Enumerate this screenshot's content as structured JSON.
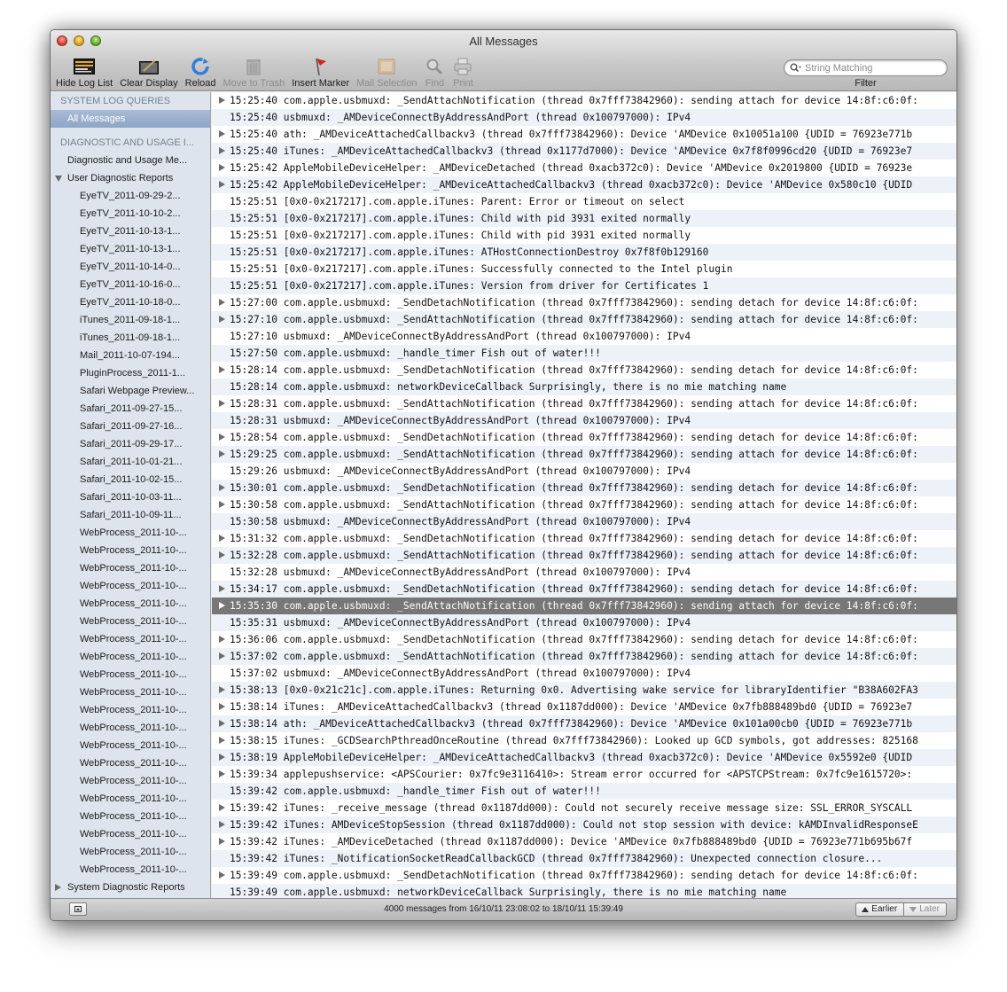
{
  "window": {
    "title": "All Messages"
  },
  "toolbar": {
    "hide_log_list": "Hide Log List",
    "clear_display": "Clear Display",
    "reload": "Reload",
    "move_to_trash": "Move to Trash",
    "insert_marker": "Insert Marker",
    "mail_selection": "Mail Selection",
    "find": "Find",
    "print": "Print",
    "filter_placeholder": "String Matching",
    "filter_label": "Filter"
  },
  "sidebar": {
    "group_system": "SYSTEM LOG QUERIES",
    "all_messages": "All Messages",
    "group_diagnostic": "DIAGNOSTIC AND USAGE I...",
    "diagnostic_usage": "Diagnostic and Usage Me...",
    "user_reports": "User Diagnostic Reports",
    "reports": [
      "EyeTV_2011-09-29-2...",
      "EyeTV_2011-10-10-2...",
      "EyeTV_2011-10-13-1...",
      "EyeTV_2011-10-13-1...",
      "EyeTV_2011-10-14-0...",
      "EyeTV_2011-10-16-0...",
      "EyeTV_2011-10-18-0...",
      "iTunes_2011-09-18-1...",
      "iTunes_2011-09-18-1...",
      "Mail_2011-10-07-194...",
      "PluginProcess_2011-1...",
      "Safari Webpage Preview...",
      "Safari_2011-09-27-15...",
      "Safari_2011-09-27-16...",
      "Safari_2011-09-29-17...",
      "Safari_2011-10-01-21...",
      "Safari_2011-10-02-15...",
      "Safari_2011-10-03-11...",
      "Safari_2011-10-09-11...",
      "WebProcess_2011-10-...",
      "WebProcess_2011-10-...",
      "WebProcess_2011-10-...",
      "WebProcess_2011-10-...",
      "WebProcess_2011-10-...",
      "WebProcess_2011-10-...",
      "WebProcess_2011-10-...",
      "WebProcess_2011-10-...",
      "WebProcess_2011-10-...",
      "WebProcess_2011-10-...",
      "WebProcess_2011-10-...",
      "WebProcess_2011-10-...",
      "WebProcess_2011-10-...",
      "WebProcess_2011-10-...",
      "WebProcess_2011-10-...",
      "WebProcess_2011-10-...",
      "WebProcess_2011-10-...",
      "WebProcess_2011-10-...",
      "WebProcess_2011-10-...",
      "WebProcess_2011-10-..."
    ],
    "system_reports": "System Diagnostic Reports"
  },
  "log": [
    {
      "text": "15:25:40 com.apple.usbmuxd: _SendAttachNotification (thread 0x7fff73842960): sending attach for device 14:8f:c6:0f:",
      "expandable": true
    },
    {
      "text": "15:25:40 usbmuxd: _AMDeviceConnectByAddressAndPort (thread 0x100797000): IPv4",
      "expandable": false
    },
    {
      "text": "15:25:40 ath: _AMDeviceAttachedCallbackv3 (thread 0x7fff73842960): Device 'AMDevice 0x10051a100 {UDID = 76923e771b",
      "expandable": true
    },
    {
      "text": "15:25:40 iTunes: _AMDeviceAttachedCallbackv3 (thread 0x1177d7000): Device 'AMDevice 0x7f8f0996cd20 {UDID = 76923e7",
      "expandable": true
    },
    {
      "text": "15:25:42 AppleMobileDeviceHelper: _AMDeviceDetached (thread 0xacb372c0): Device 'AMDevice 0x2019800 {UDID = 76923e",
      "expandable": true
    },
    {
      "text": "15:25:42 AppleMobileDeviceHelper: _AMDeviceAttachedCallbackv3 (thread 0xacb372c0): Device 'AMDevice 0x580c10 {UDID",
      "expandable": true
    },
    {
      "text": "15:25:51 [0x0-0x217217].com.apple.iTunes: Parent: Error or timeout on select",
      "expandable": false
    },
    {
      "text": "15:25:51 [0x0-0x217217].com.apple.iTunes: Child with pid 3931 exited normally",
      "expandable": false
    },
    {
      "text": "15:25:51 [0x0-0x217217].com.apple.iTunes: Child with pid 3931 exited normally",
      "expandable": false
    },
    {
      "text": "15:25:51 [0x0-0x217217].com.apple.iTunes: ATHostConnectionDestroy 0x7f8f0b129160",
      "expandable": false
    },
    {
      "text": "15:25:51 [0x0-0x217217].com.apple.iTunes: Successfully connected to the Intel plugin",
      "expandable": false
    },
    {
      "text": "15:25:51 [0x0-0x217217].com.apple.iTunes: Version from driver for Certificates 1",
      "expandable": false
    },
    {
      "text": "15:27:00 com.apple.usbmuxd: _SendDetachNotification (thread 0x7fff73842960): sending detach for device 14:8f:c6:0f:",
      "expandable": true
    },
    {
      "text": "15:27:10 com.apple.usbmuxd: _SendAttachNotification (thread 0x7fff73842960): sending attach for device 14:8f:c6:0f:",
      "expandable": true
    },
    {
      "text": "15:27:10 usbmuxd: _AMDeviceConnectByAddressAndPort (thread 0x100797000): IPv4",
      "expandable": false
    },
    {
      "text": "15:27:50 com.apple.usbmuxd: _handle_timer Fish out of water!!!",
      "expandable": false
    },
    {
      "text": "15:28:14 com.apple.usbmuxd: _SendDetachNotification (thread 0x7fff73842960): sending detach for device 14:8f:c6:0f:",
      "expandable": true
    },
    {
      "text": "15:28:14 com.apple.usbmuxd: networkDeviceCallback Surprisingly, there is no mie matching name",
      "expandable": false
    },
    {
      "text": "15:28:31 com.apple.usbmuxd: _SendAttachNotification (thread 0x7fff73842960): sending attach for device 14:8f:c6:0f:",
      "expandable": true
    },
    {
      "text": "15:28:31 usbmuxd: _AMDeviceConnectByAddressAndPort (thread 0x100797000): IPv4",
      "expandable": false
    },
    {
      "text": "15:28:54 com.apple.usbmuxd: _SendDetachNotification (thread 0x7fff73842960): sending detach for device 14:8f:c6:0f:",
      "expandable": true
    },
    {
      "text": "15:29:25 com.apple.usbmuxd: _SendAttachNotification (thread 0x7fff73842960): sending attach for device 14:8f:c6:0f:",
      "expandable": true
    },
    {
      "text": "15:29:26 usbmuxd: _AMDeviceConnectByAddressAndPort (thread 0x100797000): IPv4",
      "expandable": false
    },
    {
      "text": "15:30:01 com.apple.usbmuxd: _SendDetachNotification (thread 0x7fff73842960): sending detach for device 14:8f:c6:0f:",
      "expandable": true
    },
    {
      "text": "15:30:58 com.apple.usbmuxd: _SendAttachNotification (thread 0x7fff73842960): sending attach for device 14:8f:c6:0f:",
      "expandable": true
    },
    {
      "text": "15:30:58 usbmuxd: _AMDeviceConnectByAddressAndPort (thread 0x100797000): IPv4",
      "expandable": false
    },
    {
      "text": "15:31:32 com.apple.usbmuxd: _SendDetachNotification (thread 0x7fff73842960): sending detach for device 14:8f:c6:0f:",
      "expandable": true
    },
    {
      "text": "15:32:28 com.apple.usbmuxd: _SendAttachNotification (thread 0x7fff73842960): sending attach for device 14:8f:c6:0f:",
      "expandable": true
    },
    {
      "text": "15:32:28 usbmuxd: _AMDeviceConnectByAddressAndPort (thread 0x100797000): IPv4",
      "expandable": false
    },
    {
      "text": "15:34:17 com.apple.usbmuxd: _SendDetachNotification (thread 0x7fff73842960): sending detach for device 14:8f:c6:0f:",
      "expandable": true
    },
    {
      "text": "15:35:30 com.apple.usbmuxd: _SendAttachNotification (thread 0x7fff73842960): sending attach for device 14:8f:c6:0f:",
      "expandable": true,
      "selected": true
    },
    {
      "text": "15:35:31 usbmuxd: _AMDeviceConnectByAddressAndPort (thread 0x100797000): IPv4",
      "expandable": false
    },
    {
      "text": "15:36:06 com.apple.usbmuxd: _SendDetachNotification (thread 0x7fff73842960): sending detach for device 14:8f:c6:0f:",
      "expandable": true
    },
    {
      "text": "15:37:02 com.apple.usbmuxd: _SendAttachNotification (thread 0x7fff73842960): sending attach for device 14:8f:c6:0f:",
      "expandable": true
    },
    {
      "text": "15:37:02 usbmuxd: _AMDeviceConnectByAddressAndPort (thread 0x100797000): IPv4",
      "expandable": false
    },
    {
      "text": "15:38:13 [0x0-0x21c21c].com.apple.iTunes: Returning 0x0. Advertising wake service for libraryIdentifier \"B38A602FA3",
      "expandable": true
    },
    {
      "text": "15:38:14 iTunes: _AMDeviceAttachedCallbackv3 (thread 0x1187dd000): Device 'AMDevice 0x7fb888489bd0 {UDID = 76923e7",
      "expandable": true
    },
    {
      "text": "15:38:14 ath: _AMDeviceAttachedCallbackv3 (thread 0x7fff73842960): Device 'AMDevice 0x101a00cb0 {UDID = 76923e771b",
      "expandable": true
    },
    {
      "text": "15:38:15 iTunes: _GCDSearchPthreadOnceRoutine (thread 0x7fff73842960): Looked up GCD symbols, got addresses: 825168",
      "expandable": true
    },
    {
      "text": "15:38:19 AppleMobileDeviceHelper: _AMDeviceAttachedCallbackv3 (thread 0xacb372c0): Device 'AMDevice 0x5592e0 {UDID",
      "expandable": true
    },
    {
      "text": "15:39:34 applepushservice: <APSCourier: 0x7fc9e3116410>: Stream error occurred for <APSTCPStream: 0x7fc9e1615720>:",
      "expandable": true
    },
    {
      "text": "15:39:42 com.apple.usbmuxd: _handle_timer Fish out of water!!!",
      "expandable": false
    },
    {
      "text": "15:39:42 iTunes: _receive_message (thread 0x1187dd000): Could not securely receive message size: SSL_ERROR_SYSCALL",
      "expandable": true
    },
    {
      "text": "15:39:42 iTunes: AMDeviceStopSession (thread 0x1187dd000): Could not stop session with device: kAMDInvalidResponseE",
      "expandable": true
    },
    {
      "text": "15:39:42 iTunes: _AMDeviceDetached (thread 0x1187dd000): Device 'AMDevice 0x7fb888489bd0 {UDID = 76923e771b695b67f",
      "expandable": true
    },
    {
      "text": "15:39:42 iTunes: _NotificationSocketReadCallbackGCD (thread 0x7fff73842960): Unexpected connection closure...",
      "expandable": false
    },
    {
      "text": "15:39:49 com.apple.usbmuxd: _SendDetachNotification (thread 0x7fff73842960): sending detach for device 14:8f:c6:0f:",
      "expandable": true
    },
    {
      "text": "15:39:49 com.apple.usbmuxd: networkDeviceCallback Surprisingly, there is no mie matching name",
      "expandable": false
    }
  ],
  "status": {
    "text": "4000 messages from 16/10/11 23:08:02 to 18/10/11 15:39:49",
    "earlier": "Earlier",
    "later": "Later"
  }
}
